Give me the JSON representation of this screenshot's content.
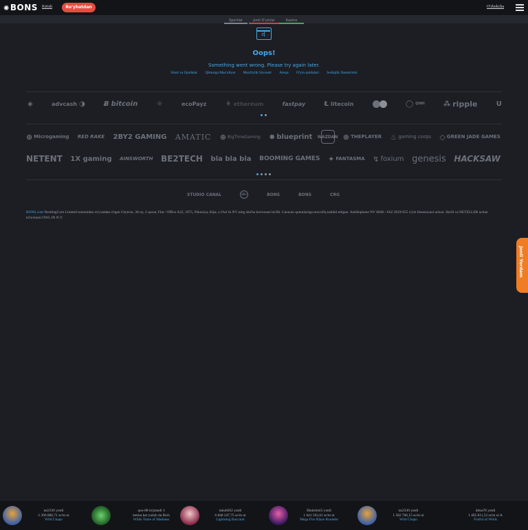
{
  "header": {
    "logo": "BONS",
    "login": "Kirish",
    "register": "Ro'yhatdan",
    "language": "O'zbekcha"
  },
  "tabs": [
    "Sportlar",
    "Jonli O'yinlar",
    "Kazino"
  ],
  "error": {
    "icon_text": ":(",
    "title": "Oops!",
    "message": "Something went wrong. Please try again later."
  },
  "footer_links": [
    "Shart va Qoidalar",
    "Qimorga Mas'uliyat",
    "Maxfiylik Siyosati",
    "Aloqa",
    "O'yin qoidalari",
    "Sodiqlik Dasturimiz"
  ],
  "payments": [
    "binance",
    "advcash",
    "bitcoin",
    "tether",
    "ecoPayz",
    "ethereum",
    "fastpay",
    "litecoin",
    "mastercard",
    "qiwi",
    "ripple",
    "unlimint"
  ],
  "payment_labels": {
    "advcash": "advcash",
    "bitcoin": "bitcoin",
    "ecopayz": "ecoPayz",
    "ethereum": "ethereum",
    "fastpay": "fastpay",
    "litecoin": "litecoin",
    "qiwi": "QIWI",
    "ripple": "ripple"
  },
  "providers_row1": {
    "microgaming": "Microgaming",
    "redrake": "RED RAKE",
    "twobytwo": "2BY2 GAMING",
    "amatic": "AMATIC",
    "bigtime": "BigTimeGaming",
    "blueprint": "blueprint",
    "wazdan": "WAZDAN",
    "theplayer": "THEPLAYER",
    "gamingcorps": "gaming corps",
    "greenjade": "GREEN JADE GAMES"
  },
  "providers_row2": {
    "netent": "NETENT",
    "onexgaming": "1X gaming",
    "ainsworth": "AINSWORTH",
    "betatech": "BE2TECH",
    "blabla": "bla bla bla",
    "booming": "BOOMING GAMES",
    "fantasma": "FANTASMA",
    "foxium": "foxium",
    "genesis": "genesis",
    "hacksaw": "HACKSAW"
  },
  "small_logos": {
    "studio": "STUDIO CANAL",
    "age": "18+",
    "bons1": "BONS",
    "bons2": "BONS",
    "badge": "CRG"
  },
  "legal": {
    "brand": "BONS.com",
    "text": " NestlingCorn Limited tomonidan ro'yxatdan o'tgan Chytron, 30-uy, 2-qavat, Flat / Office A22, 1075, Nikosiya, Kipr, u Owl In NV ning sho'ba korxonasi bo'lib. Curacao qonunlariga muvofiq tashkil etilgan. Antillephone NV 8048 / JAZ 2019-055 o'yin litsenziyasi uchun. Skrill va NETELLER uchun to'lovlarni OWL IN N.V."
  },
  "help": "Jonli Yordam",
  "winners": [
    {
      "user": "tai2330 yutdi",
      "amount": "2 396 886,71 so'm ni",
      "game": "Wild Chapo"
    },
    {
      "user": "qoo-88 to'plandi 3",
      "amount": "ketma ket yutish da Rich",
      "game": "Wilde Tome of Madness"
    },
    {
      "user": "taku0202 yutdi",
      "amount": "6 848 247,75 so'm ni",
      "game": "Lightning Baccarat"
    },
    {
      "user": "Blakshmi5 yutdi",
      "amount": "1 641 503,61 so'm ni",
      "game": "Mega Fire Blaze Roulette"
    },
    {
      "user": "tai2330 yutdi",
      "amount": "1 582 706,15 so'm ni",
      "game": "Wild Chapo"
    },
    {
      "user": "dima78 yutdi",
      "amount": "1 465 811,52 so'm ni A",
      "game": "Fistful of Wilds"
    }
  ],
  "colors": {
    "background": "#1c1e24",
    "accent": "#48a8e8",
    "register": "#ea4b3f",
    "help": "#f07c24"
  }
}
